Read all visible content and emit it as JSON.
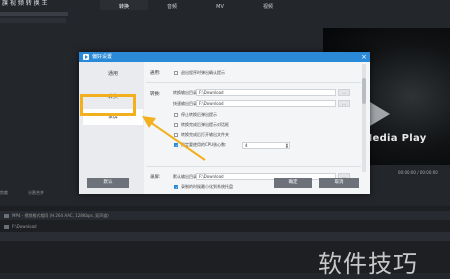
{
  "app": {
    "title": "旗 视 频 转 换 王",
    "tabs": [
      "转换",
      "音频",
      "MV",
      "视频"
    ],
    "active_tab": 0
  },
  "preview": {
    "overlay_text": "ersoft Media Play",
    "time": "00:00:00 / 00:00:00"
  },
  "bottom": {
    "left_label_1": "剪裁",
    "left_label_2": "分割合并",
    "rows": [
      "MP4 - 视频格式相同 (H.264 AAC, 128Kbps, 双声道)",
      "F:\\Download"
    ]
  },
  "dialog": {
    "title": "偏好设置",
    "close": "×",
    "nav": [
      "通用",
      "转换",
      "录屏"
    ],
    "selected_nav": 2,
    "general": {
      "label": "通用:",
      "minimize_tray": {
        "label": "退出程序时弹出确认提示",
        "checked": false
      }
    },
    "convert": {
      "label": "转换:",
      "output_dir": {
        "label": "转换输出目录:",
        "value": "F:\\Download"
      },
      "quick_dir": {
        "label": "快速输出目录:",
        "value": "F:\\Download"
      },
      "browse": "...",
      "options": [
        {
          "label": "停止转换后弹出提示",
          "checked": false
        },
        {
          "label": "转换完成后弹出提示对话框",
          "checked": false
        },
        {
          "label": "转换完成后打开输出文件夹",
          "checked": false
        },
        {
          "label": "指定要使用的CPU核心数:",
          "checked": true
        }
      ],
      "cpu_cores": "4"
    },
    "record": {
      "label": "录屏:",
      "output_dir": {
        "label": "默认输出目录:",
        "value": "F:\\Download"
      },
      "minimize": {
        "label": "录制的时候最小化到系统托盘",
        "checked": true
      }
    },
    "buttons": {
      "reset": "默认",
      "ok": "确定",
      "cancel": "取消"
    }
  },
  "colors": {
    "titlebar": "#2a8ad8",
    "highlight": "#f2b01e",
    "button": "#6c717a"
  },
  "watermark": "软件技巧"
}
